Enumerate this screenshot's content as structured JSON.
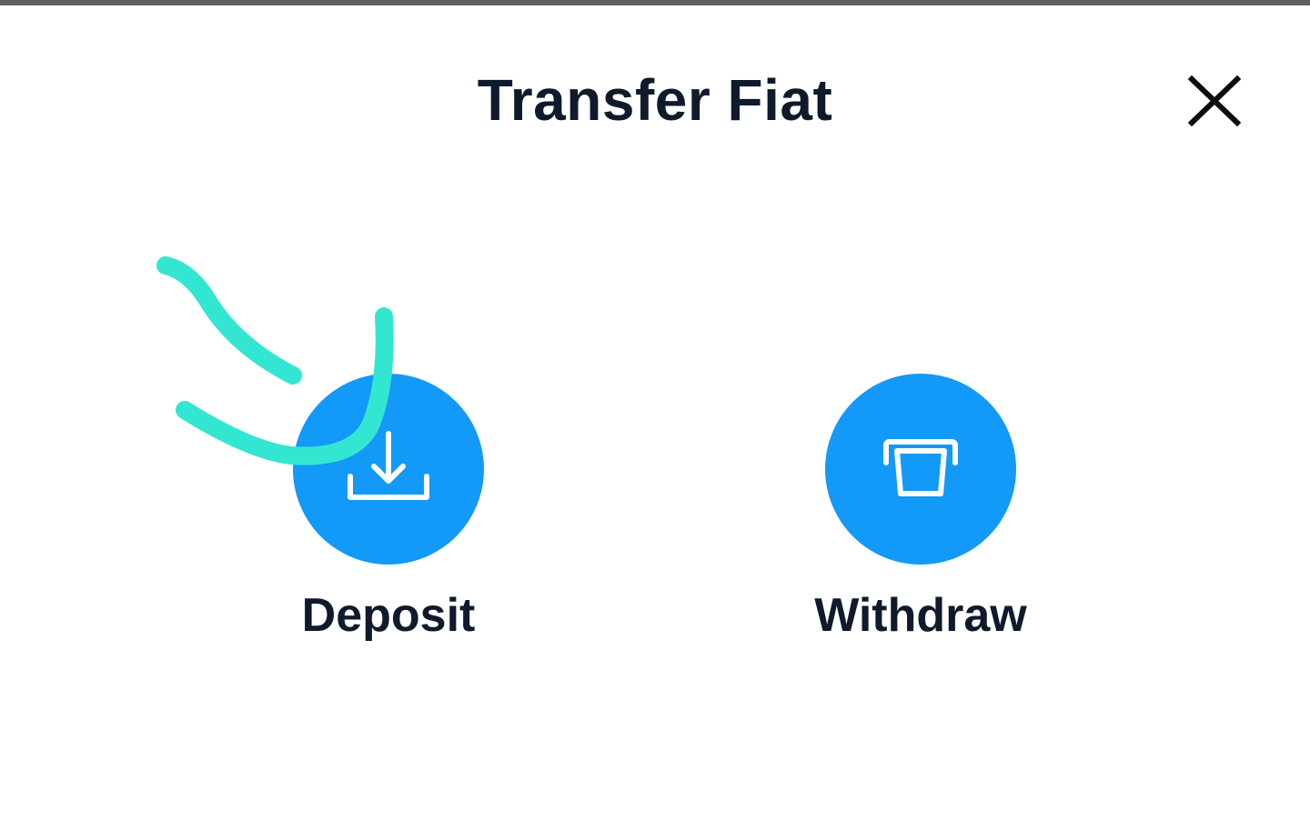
{
  "modal": {
    "title": "Transfer Fiat",
    "close_icon": "close-icon"
  },
  "actions": [
    {
      "label": "Deposit",
      "icon": "download-tray-icon"
    },
    {
      "label": "Withdraw",
      "icon": "atm-card-slot-icon"
    }
  ],
  "colors": {
    "accent": "#1399f7",
    "title_text": "#0f1a2c",
    "annotation_stroke": "#33e6d2"
  }
}
